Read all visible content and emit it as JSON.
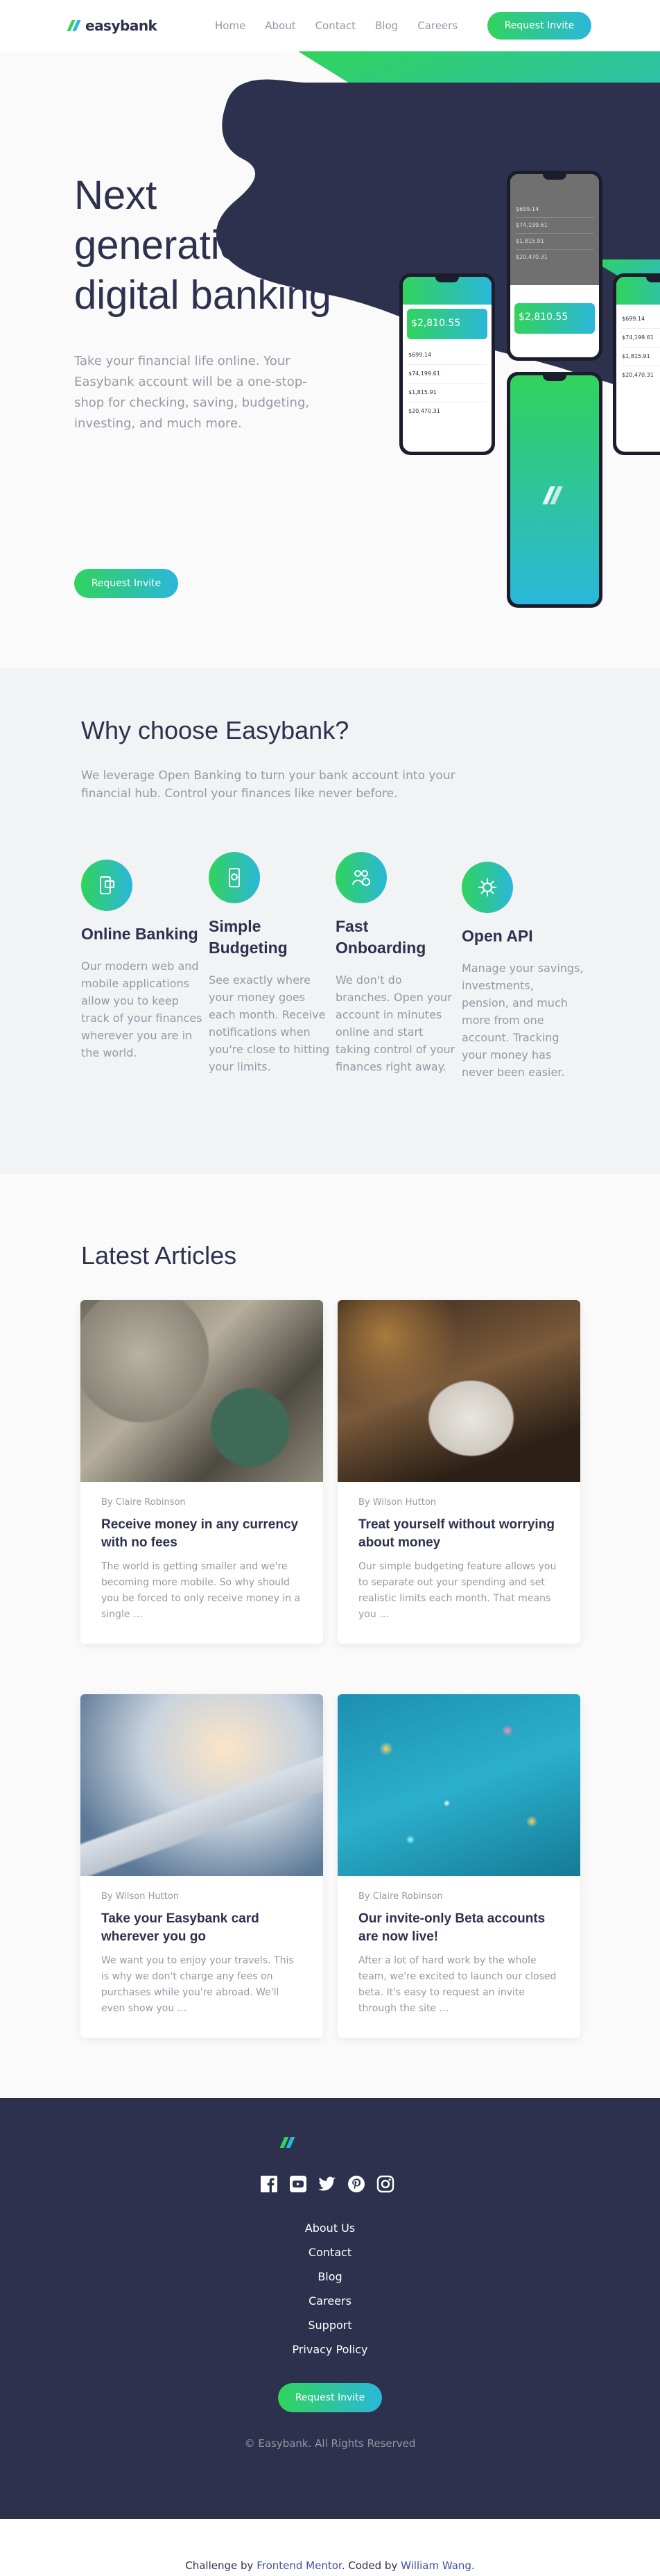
{
  "header": {
    "logo_text": "easybank",
    "nav": [
      "Home",
      "About",
      "Contact",
      "Blog",
      "Careers"
    ],
    "cta_label": "Request Invite"
  },
  "hero": {
    "title": "Next generation digital banking",
    "description": "Take your financial life online. Your Easybank account will be a one-stop-shop for checking, saving, budgeting, investing, and much more.",
    "cta_label": "Request Invite",
    "phone_balance": "$2,810.55",
    "phone_rows": [
      "$699.14",
      "$74,199.61",
      "$1,815.91",
      "$20,470.31"
    ]
  },
  "why": {
    "title": "Why choose Easybank?",
    "intro": "We leverage Open Banking to turn your bank account into your financial hub. Control your finances like never before.",
    "features": [
      {
        "icon": "online-banking-icon",
        "title": "Online Banking",
        "desc": "Our modern web and mobile applications allow you to keep track of your finances wherever you are in the world."
      },
      {
        "icon": "budgeting-icon",
        "title": "Simple Budgeting",
        "desc": "See exactly where your money goes each month. Receive notifications when you're close to hitting your limits."
      },
      {
        "icon": "onboarding-icon",
        "title": "Fast Onboarding",
        "desc": "We don't do branches. Open your account in minutes online and start taking control of your finances right away."
      },
      {
        "icon": "api-icon",
        "title": "Open API",
        "desc": "Manage your savings, investments, pension, and much more from one account. Tracking your money has never been easier."
      }
    ]
  },
  "articles": {
    "title": "Latest Articles",
    "items": [
      {
        "author": "By Claire Robinson",
        "title": "Receive money in any currency with no fees",
        "excerpt": "The world is getting smaller and we're becoming more mobile. So why should you be forced to only receive money in a single …"
      },
      {
        "author": "By Wilson Hutton",
        "title": "Treat yourself without worrying about money",
        "excerpt": "Our simple budgeting feature allows you to separate out your spending and set realistic limits each month. That means you …"
      },
      {
        "author": "By Wilson Hutton",
        "title": "Take your Easybank card wherever you go",
        "excerpt": "We want you to enjoy your travels. This is why we don't charge any fees on purchases while you're abroad. We'll even show you …"
      },
      {
        "author": "By Claire Robinson",
        "title": "Our invite-only Beta accounts are now live!",
        "excerpt": "After a lot of hard work by the whole team, we're excited to launch our closed beta. It's easy to request an invite through the site …"
      }
    ]
  },
  "footer": {
    "links": [
      "About Us",
      "Contact",
      "Blog",
      "Careers",
      "Support",
      "Privacy Policy"
    ],
    "cta_label": "Request Invite",
    "copyright": "© Easybank. All Rights Reserved",
    "socials": [
      "facebook-icon",
      "youtube-icon",
      "twitter-icon",
      "pinterest-icon",
      "instagram-icon"
    ]
  },
  "attribution": {
    "prefix": "Challenge by",
    "link1": "Frontend Mentor",
    "middle": ". Coded by",
    "link2": "William Wang",
    "suffix": "."
  },
  "colors": {
    "dark_blue": "#2d314d",
    "lime_green": "#31d35c",
    "bright_cyan": "#2bb7da",
    "grayish_blue": "#9698a6",
    "light_gray": "#f2f3f5"
  }
}
